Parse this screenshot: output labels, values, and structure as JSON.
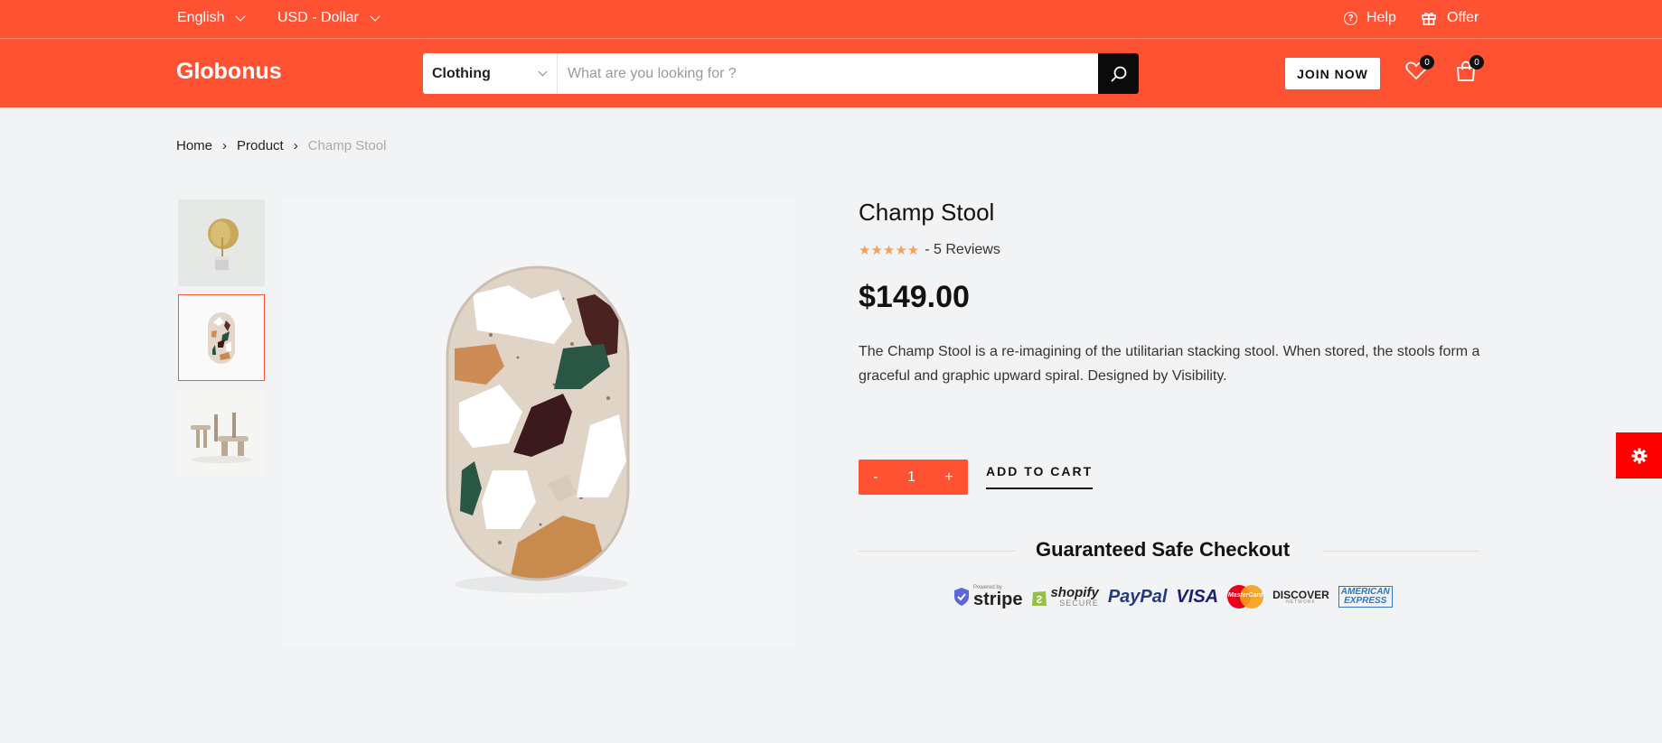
{
  "topbar": {
    "language": "English",
    "currency": "USD - Dollar",
    "help_label": "Help",
    "offer_label": "Offer"
  },
  "header": {
    "logo": "Globonus",
    "search": {
      "category": "Clothing",
      "placeholder": "What are you looking for ?"
    },
    "join_label": "JOIN NOW",
    "wishlist_count": "0",
    "cart_count": "0"
  },
  "breadcrumb": {
    "items": [
      "Home",
      "Product",
      "Champ Stool"
    ],
    "separator": "›"
  },
  "product": {
    "title": "Champ Stool",
    "stars": "★★★★★",
    "rating_value": 5,
    "reviews_label": "- 5 Reviews",
    "price": "$149.00",
    "description": "The Champ Stool is a re-imagining of the utilitarian stacking stool. When stored, the stools form a graceful and graphic upward spiral. Designed by Visibility.",
    "quantity": "1",
    "minus": "-",
    "plus": "+",
    "add_to_cart": "ADD TO CART",
    "active_thumbnail": 2
  },
  "checkout": {
    "title": "Guaranteed Safe Checkout",
    "payment_methods": {
      "stripe_small": "Powered by",
      "stripe": "stripe",
      "shopify": "shopify",
      "shopify_sub": "SECURE",
      "paypal": "PayPal",
      "visa": "VISA",
      "mastercard": "MasterCard",
      "discover": "DISCOVER",
      "discover_sub": "NETWORK",
      "amex_1": "AMERICAN",
      "amex_2": "EXPRESS"
    }
  },
  "colors": {
    "brand": "#ff5233",
    "dark": "#0b0b0b",
    "background": "#f2f3f5",
    "settings_button": "#ff0000"
  }
}
